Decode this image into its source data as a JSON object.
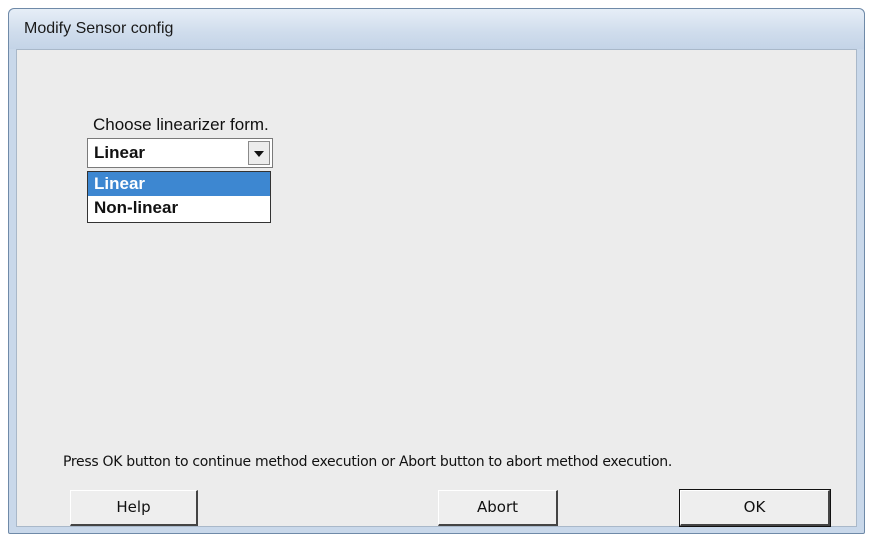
{
  "window": {
    "title": "Modify Sensor config"
  },
  "prompt": {
    "label": "Choose linearizer form."
  },
  "combo": {
    "selected": "Linear",
    "options": [
      "Linear",
      "Non-linear"
    ]
  },
  "status": {
    "message": "Press OK button to continue method execution or Abort button to abort method execution."
  },
  "buttons": {
    "help": "Help",
    "abort": "Abort",
    "ok": "OK"
  }
}
